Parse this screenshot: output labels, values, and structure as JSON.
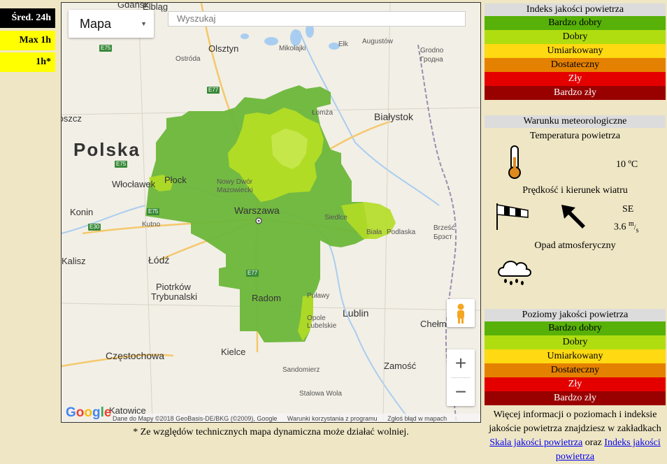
{
  "tabs": [
    {
      "label": "Śred. 24h",
      "active": true
    },
    {
      "label": "Max 1h",
      "active": false
    },
    {
      "label": "1h*",
      "active": false
    }
  ],
  "map": {
    "type_select": "Mapa",
    "search_placeholder": "Wyszukaj",
    "country_label": "Polska",
    "cities": {
      "gdansk": "Gdańsk",
      "elblag": "Elbląg",
      "olsztyn": "Olsztyn",
      "mikolajki": "Mikołajki",
      "elk": "Ełk",
      "augustow": "Augustów",
      "grodno": "Grodno",
      "grodno_cyr": "Гродна",
      "ostroda": "Ostróda",
      "gorzow": "Bydgoszcz",
      "lomza": "Łomża",
      "bialystok": "Białystok",
      "plock": "Płock",
      "wloclawek": "Włocławek",
      "nowy_dwor": "Nowy Dwór",
      "mazowiecki": "Mazowiecki",
      "warszawa": "Warszawa",
      "siedlce": "Siedlce",
      "biala": "Biała",
      "podlaska": "Podlaska",
      "brzesc": "Brześć",
      "brest_cyr": "Брэст",
      "konin": "Konin",
      "kutno": "Kutno",
      "kalisz": "Kalisz",
      "lodz": "Łódź",
      "piotrkow": "Piotrków",
      "trybunalski": "Trybunalski",
      "radom": "Radom",
      "pulawy": "Puławy",
      "opole": "Opole",
      "lubelskie": "Lubelskie",
      "lublin": "Lublin",
      "chelm": "Chełm",
      "czestochowa": "Częstochowa",
      "kielce": "Kielce",
      "sandomierz": "Sandomierz",
      "zamosc": "Zamość",
      "stalowa": "Stalowa Wola",
      "katowice": "Katowice"
    },
    "roads": [
      "E75",
      "E77",
      "E75",
      "E30",
      "E75",
      "E77"
    ],
    "attribution": [
      "Dane do Mapy ©2018 GeoBasis-DE/BKG (©2009), Google",
      "Warunki korzystania z programu",
      "Zgłoś błąd w mapach"
    ],
    "google_logo": "Google",
    "zoom_in": "+",
    "zoom_out": "−"
  },
  "footnote": "* Ze względów technicznych mapa dynamiczna może działać wolniej.",
  "index_panel": {
    "title": "Indeks jakości powietrza",
    "levels": [
      "Bardzo dobry",
      "Dobry",
      "Umiarkowany",
      "Dostateczny",
      "Zły",
      "Bardzo zły"
    ]
  },
  "weather_panel": {
    "title": "Warunku meteorologiczne",
    "temperature_label": "Temperatura powietrza",
    "temperature_value": "10 ºC",
    "wind_label": "Prędkość i kierunek wiatru",
    "wind_direction": "SE",
    "wind_speed": "3.6",
    "wind_unit_top": "m",
    "wind_unit_bottom": "s",
    "precip_label": "Opad atmosferyczny",
    "icons": [
      "thermometer-icon",
      "windsock-icon",
      "wind-arrow-icon",
      "rain-cloud-icon"
    ]
  },
  "levels_panel": {
    "title": "Poziomy jakości powietrza",
    "levels": [
      "Bardzo dobry",
      "Dobry",
      "Umiarkowany",
      "Dostateczny",
      "Zły",
      "Bardzo zły"
    ]
  },
  "info": {
    "text1": "Więcej informacji o poziomach i indeksie jakoście powietrza znajdziesz w zakładkach",
    "link1": "Skala jakości powietrza",
    "text2": "oraz",
    "link2": "Indeks jakości powietrza"
  },
  "colors": {
    "level1": "#57b108",
    "level2": "#b0dd10",
    "level3": "#ffd911",
    "level4": "#e58100",
    "level5": "#e50000",
    "level6": "#990000",
    "background": "#efe6c5"
  }
}
